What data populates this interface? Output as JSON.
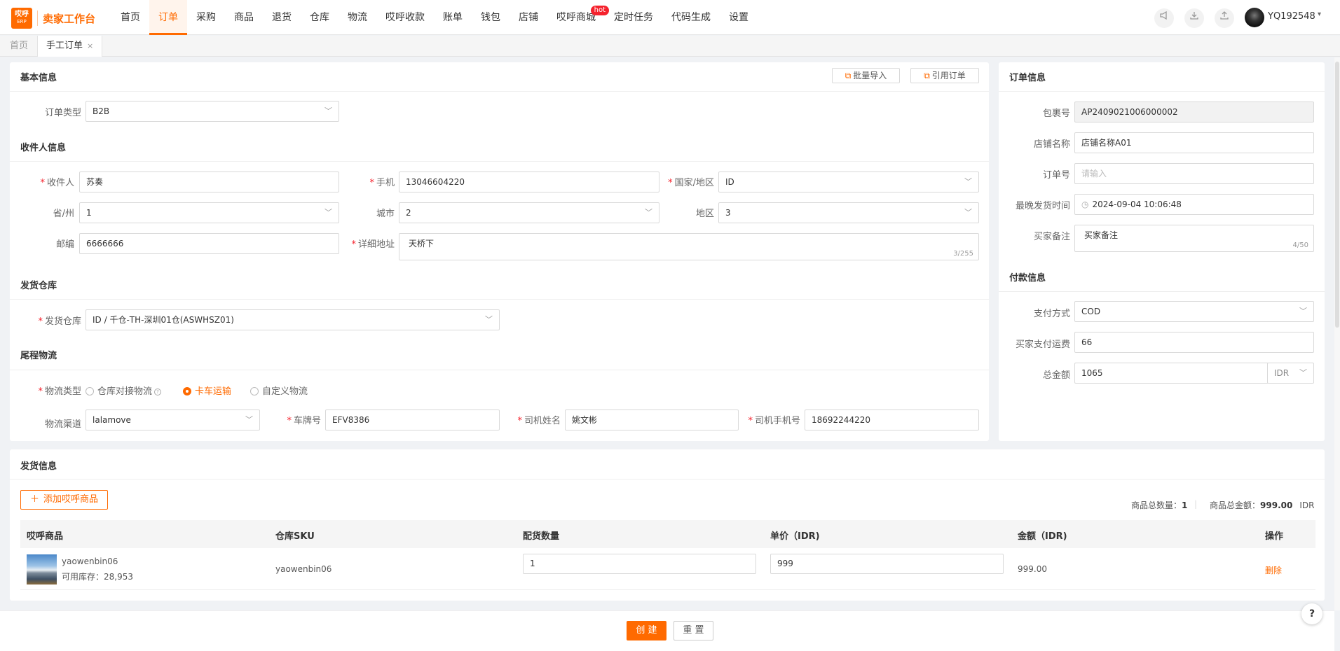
{
  "app": {
    "logo_top": "哎呼",
    "logo_sub": "ERP",
    "title": "卖家工作台"
  },
  "nav": [
    "首页",
    "订单",
    "采购",
    "商品",
    "退货",
    "仓库",
    "物流",
    "哎呼收款",
    "账单",
    "钱包",
    "店铺",
    "哎呼商城",
    "定时任务",
    "代码生成",
    "设置"
  ],
  "nav_badge": "hot",
  "user": {
    "name": "YQ192548"
  },
  "tabs": [
    {
      "label": "首页"
    },
    {
      "label": "手工订单",
      "close": "×"
    }
  ],
  "basic": {
    "title": "基本信息",
    "batch_import": "批量导入",
    "quote_order": "引用订单",
    "order_type_label": "订单类型",
    "order_type": "B2B"
  },
  "recipient": {
    "title": "收件人信息",
    "name_label": "收件人",
    "name": "苏奏",
    "phone_label": "手机",
    "phone": "13046604220",
    "country_label": "国家/地区",
    "country": "ID",
    "province_label": "省/州",
    "province": "1",
    "city_label": "城市",
    "city": "2",
    "district_label": "地区",
    "district": "3",
    "zip_label": "邮编",
    "zip": "6666666",
    "address_label": "详细地址",
    "address": "天桥下",
    "address_count": "3/255"
  },
  "warehouse": {
    "title": "发货仓库",
    "label": "发货仓库",
    "value": "ID / 千仓-TH-深圳01仓(ASWHSZ01)"
  },
  "logistics": {
    "title": "尾程物流",
    "type_label": "物流类型",
    "options": [
      "仓库对接物流",
      "卡车运输",
      "自定义物流"
    ],
    "selected": "卡车运输",
    "channel_label": "物流渠道",
    "channel": "lalamove",
    "plate_label": "车牌号",
    "plate": "EFV8386",
    "driver_label": "司机姓名",
    "driver": "姚文彬",
    "driver_phone_label": "司机手机号",
    "driver_phone": "18692244220"
  },
  "order_info": {
    "title": "订单信息",
    "package_label": "包裹号",
    "package": "AP2409021006000002",
    "shop_label": "店铺名称",
    "shop": "店铺名称A01",
    "order_no_label": "订单号",
    "order_no_placeholder": "请输入",
    "deadline_label": "最晚发货时间",
    "deadline": "2024-09-04 10:06:48",
    "remark_label": "买家备注",
    "remark": "买家备注",
    "remark_count": "4/50"
  },
  "payment": {
    "title": "付款信息",
    "method_label": "支付方式",
    "method": "COD",
    "freight_label": "买家支付运费",
    "freight": "66",
    "total_label": "总金额",
    "total": "1065",
    "currency": "IDR"
  },
  "shipment": {
    "title": "发货信息",
    "add_button": "添加哎呼商品",
    "total_qty_label": "商品总数量：",
    "total_qty": "1",
    "total_amount_label": "商品总金额：",
    "total_amount": "999.00",
    "total_currency": "IDR",
    "columns": [
      "哎呼商品",
      "仓库SKU",
      "配货数量",
      "单价（IDR)",
      "金额（IDR)",
      "操作"
    ],
    "rows": [
      {
        "name": "yaowenbin06",
        "stock": "可用库存：28,953",
        "sku": "yaowenbin06",
        "qty": "1",
        "price": "999",
        "amount": "999.00",
        "action": "删除"
      }
    ]
  },
  "footer": {
    "create": "创 建",
    "reset": "重 置"
  },
  "help": "?",
  "colors": {
    "accent": "#ff6a00",
    "required": "#f5222d"
  }
}
